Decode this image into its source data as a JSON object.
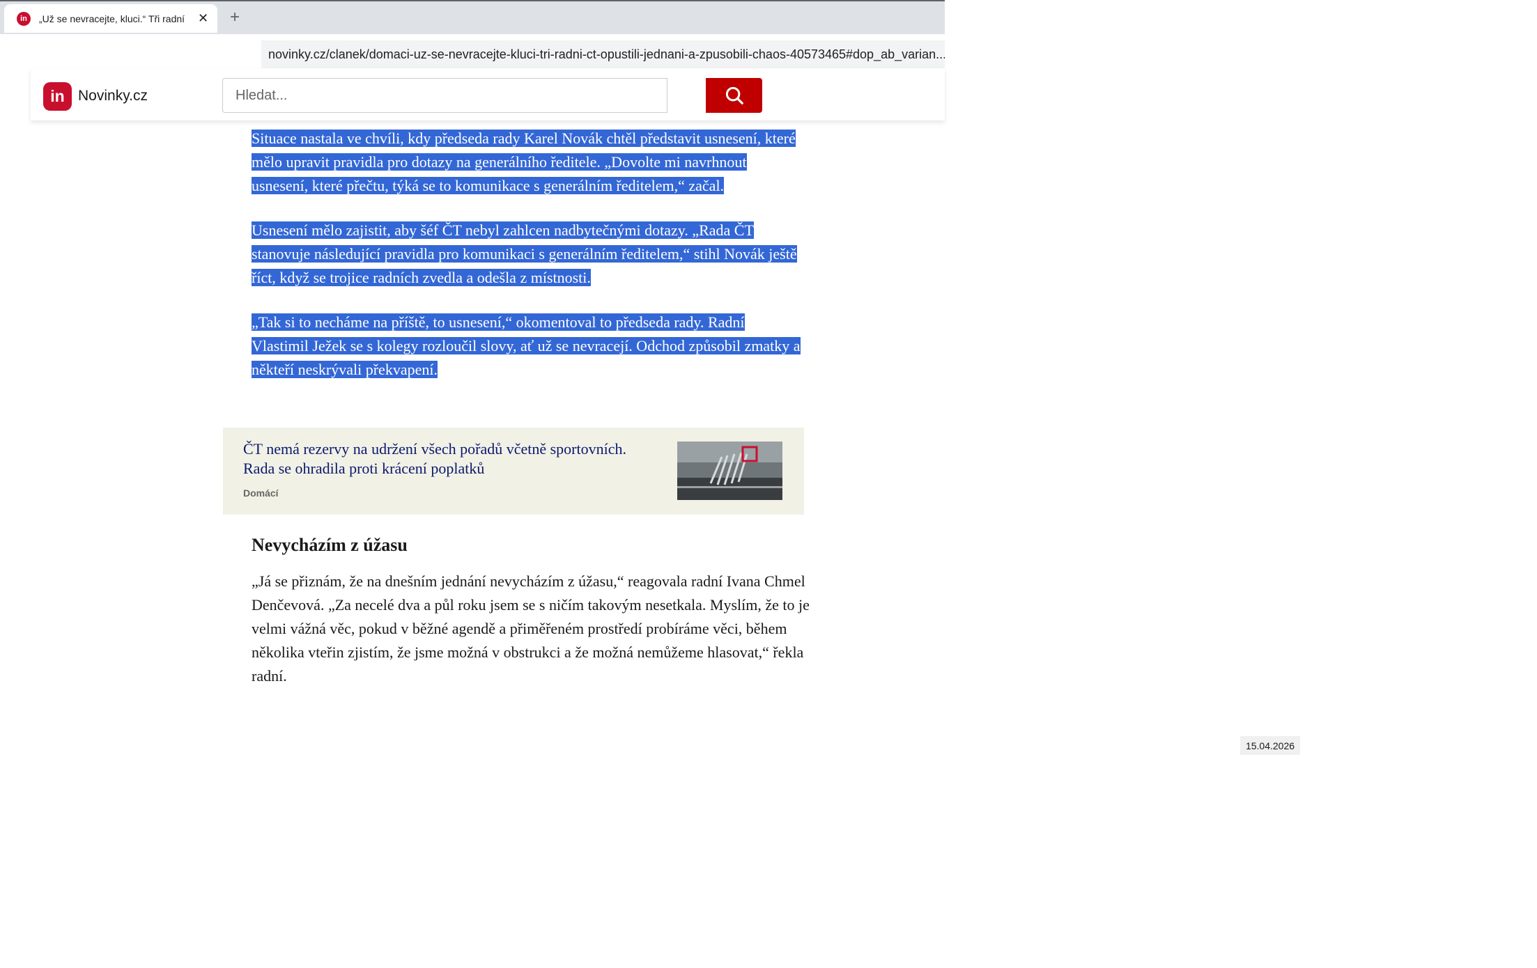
{
  "browser": {
    "tab_title": "„Už se nevracejte, kluci.“ Tři radní",
    "new_tab_symbol": "+",
    "close_symbol": "✕",
    "url": "novinky.cz/clanek/domaci-uz-se-nevracejte-kluci-tri-radni-ct-opustili-jednani-a-zpusobili-chaos-40573465#dop_ab_varian..."
  },
  "header": {
    "logo_text": "in",
    "site_name": "Novinky.cz",
    "search_placeholder": "Hledat..."
  },
  "article": {
    "paragraphs": [
      "Situace nastala ve chvíli, kdy předseda rady Karel Novák chtěl představit usnesení, které mělo upravit pravidla pro dotazy na generálního ředitele. „Dovolte mi navrhnout usnesení, které přečtu, týká se to komunikace s generálním ředitelem,“ začal.",
      "Usnesení mělo zajistit, aby šéf ČT nebyl zahlcen nadbytečnými dotazy. „Rada ČT stanovuje následující pravidla pro komunikaci s generálním ředitelem,“ stihl Novák ještě říct, když se trojice radních zvedla a odešla z místnosti.",
      "„Tak si to necháme na příště, to usnesení,“ okomentoval to předseda rady. Radní Vlastimil Ježek se s kolegy rozloučil slovy, ať už se nevracejí. Odchod způsobil zmatky a někteří neskrývali překvapení."
    ],
    "related": {
      "title": "ČT nemá rezervy na udržení všech pořadů včetně sportovních. Rada se ohradila proti krácení poplatků",
      "section": "Domácí"
    },
    "subheading": "Nevycházím z úžasu",
    "body": "„Já se přiznám, že na dnešním jednání nevycházím z úžasu,“ reagovala radní Ivana Chmel Denčevová. „Za necelé dva a půl roku jsem se s ničím takovým nesetkala. Myslím, že to je velmi vážná věc, pokud v běžné agendě a přiměřeném prostředí probíráme věci, během několika vteřin zjistím, že jsme možná v obstrukci a že možná nemůžeme hlasovat,“ řekla radní."
  },
  "taskbar": {
    "date": "15.04.2026"
  },
  "colors": {
    "brand_red": "#c8102e",
    "search_button": "#c00000",
    "selection": "#3367d6",
    "related_bg": "#f2f1e6",
    "related_title": "#0a1a6e"
  }
}
